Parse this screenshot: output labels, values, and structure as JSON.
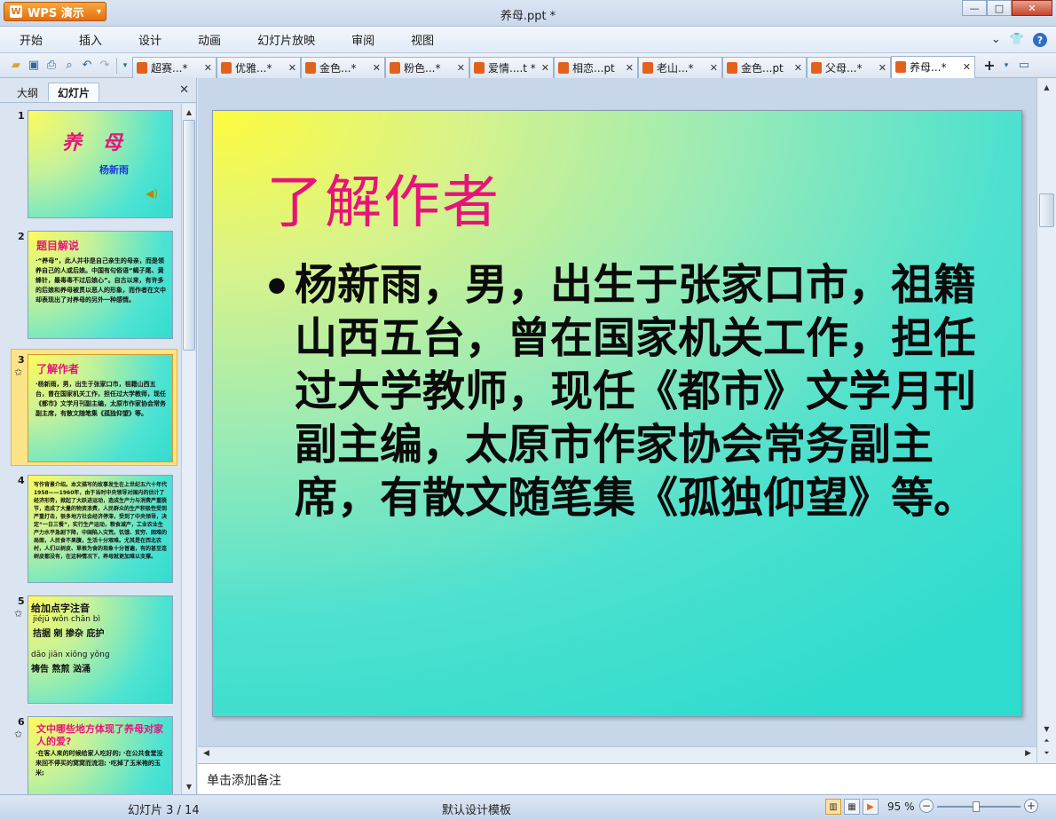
{
  "app": {
    "name": "WPS 演示",
    "window_title": "养母.ppt *"
  },
  "window_controls": {
    "minimize": "—",
    "maximize": "□",
    "close": "✕"
  },
  "menu": [
    "开始",
    "插入",
    "设计",
    "动画",
    "幻灯片放映",
    "审阅",
    "视图"
  ],
  "menu_right": {
    "collapse": "⌄",
    "skin": "👕",
    "help": "?"
  },
  "tabs": [
    {
      "label": "超赛...*",
      "active": false
    },
    {
      "label": "优雅...*",
      "active": false
    },
    {
      "label": "金色...*",
      "active": false
    },
    {
      "label": "粉色...*",
      "active": false
    },
    {
      "label": "爱情....t *",
      "active": false
    },
    {
      "label": "相恋...pt",
      "active": false
    },
    {
      "label": "老山...*",
      "active": false
    },
    {
      "label": "金色...pt",
      "active": false
    },
    {
      "label": "父母...*",
      "active": false
    },
    {
      "label": "养母...*",
      "active": true
    }
  ],
  "tab_close": "✕",
  "left_panel": {
    "tab_outline": "大纲",
    "tab_slides": "幻灯片",
    "close": "✕",
    "slides": [
      {
        "num": "1",
        "title": "养 母",
        "author": "杨新雨"
      },
      {
        "num": "2",
        "title": "题目解说",
        "body": "·“养母”，此人并非是自己亲生的母亲，而是领养自己的人或后娘。中国有句俗语“蝎子尾、黄蜂针，最毒毒不过后娘心”。自古以来，有许多的后娘和养母被贯以恶人的形象，而作者在文中却表现出了对养母的另外一种感情。"
      },
      {
        "num": "3",
        "title": "了解作者",
        "body": "·杨新雨，男，出生于张家口市，祖籍山西五台，曾在国家机关工作，担任过大学教师，现任《都市》文学月刊副主编，太原市作家协会常务副主席，有散文随笔集《孤独仰望》等。"
      },
      {
        "num": "4",
        "body": "写作背景介绍。本文描写的故事发生在上世纪五六十年代1958——1960年，由于当时中央领导对国内的估计了经济形势，掀起了大跃进运动，造成生产力与消费严重脱节，造成了大量的物资浪费，人民群众的生产积极性受到严重打击，很多地方社会经济停滞，受到了中央领导，决定“一日三餐”，实行生产运动，粮食减产，工业农业生产力水平急剧下降，中国陷入灾荒。饥饿、贫穷、困难的局面，人民食不果腹，生活十分艰难。尤其是在西北农村，人们以树皮、草根为食的现象十分普遍，有的甚至连树皮都没有，在这种情况下，养母就更加难以支撑。"
      },
      {
        "num": "5",
        "title": "给加点字注音",
        "pinyin1": "jiéjū      wǒn   chān        bì",
        "words1": "拮据    剜    掺杂     庇护",
        "pinyin2": "dǎo          jiān   xiōng yǒng",
        "words2": "祷告    熬煎    汹涌"
      },
      {
        "num": "6",
        "title": "文中哪些地方体现了养母对家人的爱?",
        "body": "·在客人来的时候给家人吃好的;  ·在公共食堂没来回不停买的窝窝而流泪;  ·吃掉了玉米袍的玉米;"
      }
    ]
  },
  "slide": {
    "title": "了解作者",
    "bullet": "•",
    "body": "杨新雨，男，出生于张家口市，祖籍山西五台，曾在国家机关工作，担任过大学教师，现任《都市》文学月刊副主编，太原市作家协会常务副主席，有散文随笔集《孤独仰望》等。"
  },
  "notes_placeholder": "单击添加备注",
  "status": {
    "slide_index": "幻灯片 3 / 14",
    "template": "默认设计模板",
    "zoom": "95 %",
    "zoom_level": 0.46
  }
}
